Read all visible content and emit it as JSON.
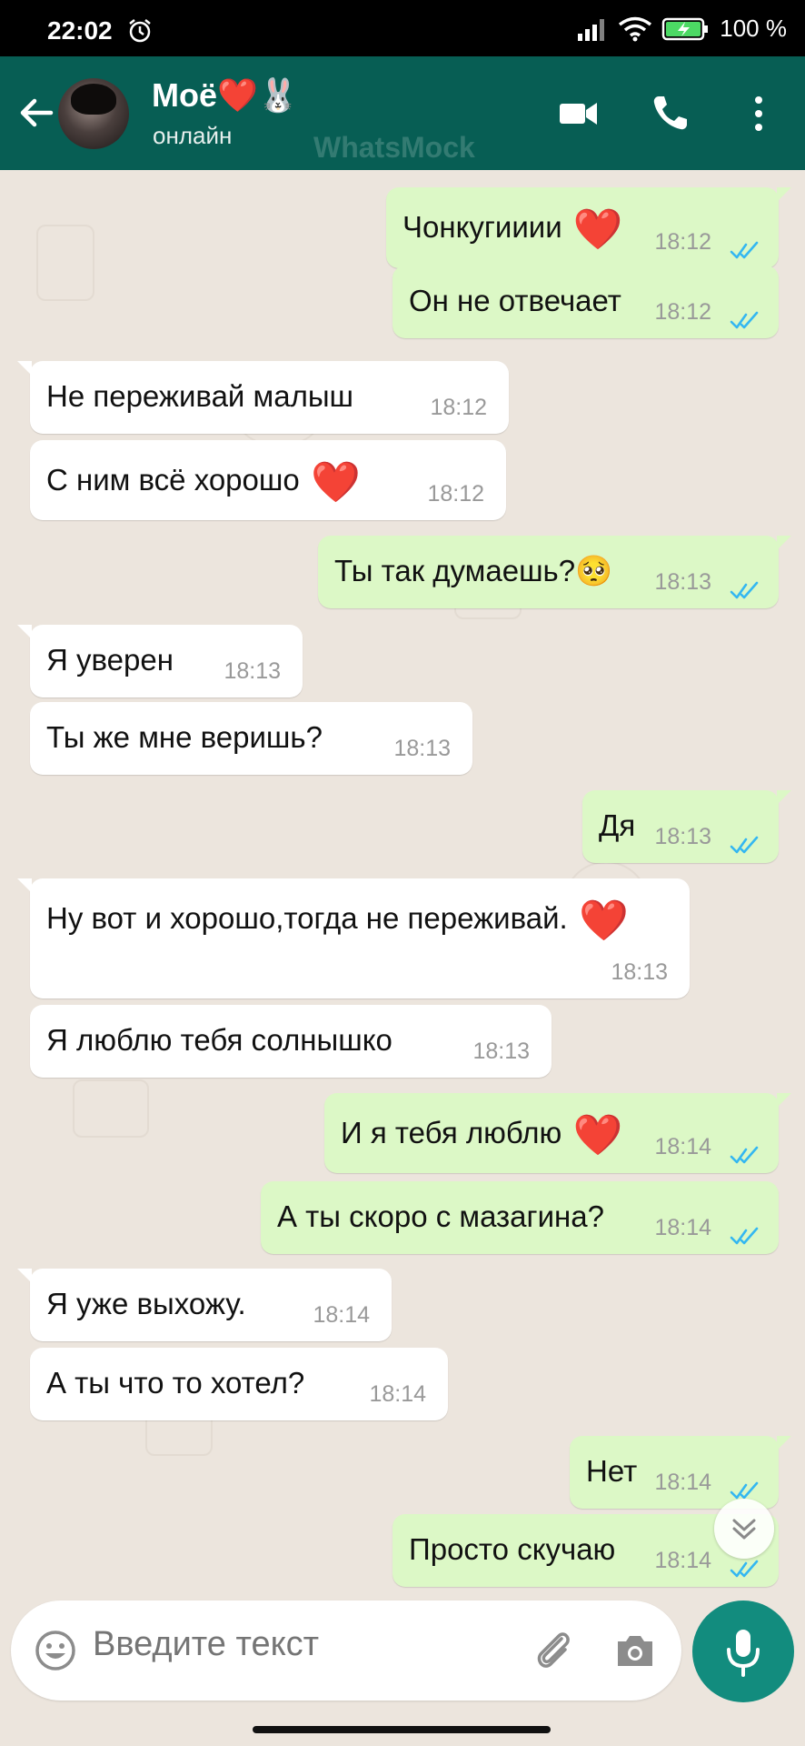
{
  "status_bar": {
    "time": "22:02",
    "battery": "100 %"
  },
  "header": {
    "contact_name": "Моё",
    "name_emoji": "❤️🐰",
    "status": "онлайн",
    "watermark": "WhatsMock"
  },
  "colors": {
    "header": "#075e54",
    "outgoing": "#dcf8c6",
    "incoming": "#ffffff",
    "read_ticks": "#34b7f1",
    "mic": "#128c7e"
  },
  "messages": [
    {
      "direction": "out",
      "text": "Чонкугииии",
      "emoji": "❤️",
      "time": "18:12",
      "status": "read"
    },
    {
      "direction": "out",
      "text": "Он не отвечает",
      "time": "18:12",
      "status": "read"
    },
    {
      "direction": "in",
      "text": "Не переживай малыш",
      "time": "18:12"
    },
    {
      "direction": "in",
      "text": "С ним всё хорошо",
      "emoji": "❤️",
      "time": "18:12"
    },
    {
      "direction": "out",
      "text": "Ты так думаешь?",
      "emoji": "🥺",
      "time": "18:13",
      "status": "read"
    },
    {
      "direction": "in",
      "text": "Я уверен",
      "time": "18:13"
    },
    {
      "direction": "in",
      "text": "Ты же мне веришь?",
      "time": "18:13"
    },
    {
      "direction": "out",
      "text": "Дя",
      "time": "18:13",
      "status": "read"
    },
    {
      "direction": "in",
      "text": "Ну вот и хорошо,тогда не переживай.",
      "emoji": "❤️",
      "time": "18:13"
    },
    {
      "direction": "in",
      "text": "Я люблю тебя солнышко",
      "time": "18:13"
    },
    {
      "direction": "out",
      "text": "И я тебя люблю",
      "emoji": "❤️",
      "time": "18:14",
      "status": "read"
    },
    {
      "direction": "out",
      "text": "А ты скоро с мазагина?",
      "time": "18:14",
      "status": "read"
    },
    {
      "direction": "in",
      "text": "Я уже выхожу.",
      "time": "18:14"
    },
    {
      "direction": "in",
      "text": "А ты что то хотел?",
      "time": "18:14"
    },
    {
      "direction": "out",
      "text": "Нет",
      "time": "18:14",
      "status": "read"
    },
    {
      "direction": "out",
      "text": "Просто скучаю",
      "time": "18:14",
      "status": "read"
    }
  ],
  "composer": {
    "placeholder": "Введите текст"
  },
  "icons": [
    "back-arrow-icon",
    "video-call-icon",
    "phone-icon",
    "more-vert-icon",
    "emoji-icon",
    "attach-icon",
    "camera-icon",
    "mic-icon",
    "scroll-down-icon",
    "double-check-icon"
  ]
}
